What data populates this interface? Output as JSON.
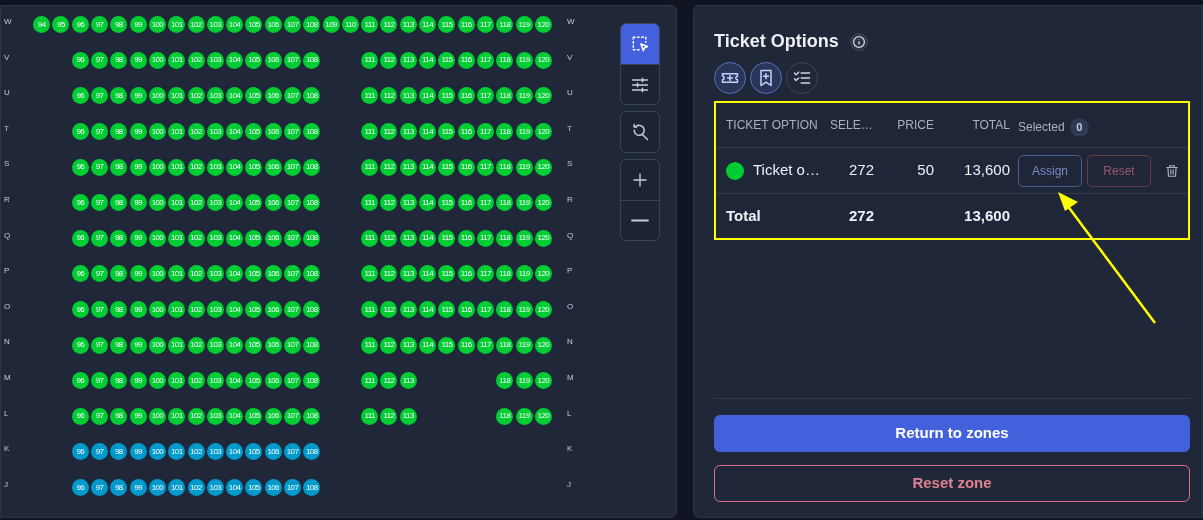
{
  "seat_map": {
    "rows": [
      {
        "label_left": "W",
        "label_right": "W",
        "color": "#00cc33",
        "seats": [
          {
            "kind": "seat",
            "number": "94"
          },
          {
            "kind": "seat",
            "number": "95"
          },
          {
            "kind": "seat",
            "number": "96"
          },
          {
            "kind": "seat",
            "number": "97"
          },
          {
            "kind": "seat",
            "number": "98"
          },
          {
            "kind": "seat",
            "number": "99"
          },
          {
            "kind": "seat",
            "number": "100"
          },
          {
            "kind": "seat",
            "number": "101"
          },
          {
            "kind": "seat",
            "number": "102"
          },
          {
            "kind": "seat",
            "number": "103"
          },
          {
            "kind": "seat",
            "number": "104"
          },
          {
            "kind": "seat",
            "number": "105"
          },
          {
            "kind": "seat",
            "number": "106"
          },
          {
            "kind": "seat",
            "number": "107"
          },
          {
            "kind": "seat",
            "number": "108"
          },
          {
            "kind": "seat",
            "number": "109"
          },
          {
            "kind": "seat",
            "number": "110"
          },
          {
            "kind": "seat",
            "number": "111"
          },
          {
            "kind": "seat",
            "number": "112"
          },
          {
            "kind": "seat",
            "number": "113"
          },
          {
            "kind": "seat",
            "number": "114"
          },
          {
            "kind": "seat",
            "number": "115"
          },
          {
            "kind": "seat",
            "number": "116"
          },
          {
            "kind": "seat",
            "number": "117"
          },
          {
            "kind": "seat",
            "number": "118"
          },
          {
            "kind": "seat",
            "number": "119"
          },
          {
            "kind": "seat",
            "number": "120"
          }
        ]
      },
      {
        "label_left": "V",
        "label_right": "V",
        "color": "#00cc33",
        "seats": [
          {
            "kind": "gap"
          },
          {
            "kind": "gap"
          },
          {
            "kind": "seat",
            "number": "96"
          },
          {
            "kind": "seat",
            "number": "97"
          },
          {
            "kind": "seat",
            "number": "98"
          },
          {
            "kind": "seat",
            "number": "99"
          },
          {
            "kind": "seat",
            "number": "100"
          },
          {
            "kind": "seat",
            "number": "101"
          },
          {
            "kind": "seat",
            "number": "102"
          },
          {
            "kind": "seat",
            "number": "103"
          },
          {
            "kind": "seat",
            "number": "104"
          },
          {
            "kind": "seat",
            "number": "105"
          },
          {
            "kind": "seat",
            "number": "106"
          },
          {
            "kind": "seat",
            "number": "107"
          },
          {
            "kind": "seat",
            "number": "108"
          },
          {
            "kind": "gap"
          },
          {
            "kind": "gap"
          },
          {
            "kind": "seat",
            "number": "111"
          },
          {
            "kind": "seat",
            "number": "112"
          },
          {
            "kind": "seat",
            "number": "113"
          },
          {
            "kind": "seat",
            "number": "114"
          },
          {
            "kind": "seat",
            "number": "115"
          },
          {
            "kind": "seat",
            "number": "116"
          },
          {
            "kind": "seat",
            "number": "117"
          },
          {
            "kind": "seat",
            "number": "118"
          },
          {
            "kind": "seat",
            "number": "119"
          },
          {
            "kind": "seat",
            "number": "120"
          }
        ]
      },
      {
        "label_left": "U",
        "label_right": "U",
        "color": "#00cc33",
        "seats": [
          {
            "kind": "gap"
          },
          {
            "kind": "gap"
          },
          {
            "kind": "seat",
            "number": "96"
          },
          {
            "kind": "seat",
            "number": "97"
          },
          {
            "kind": "seat",
            "number": "98"
          },
          {
            "kind": "seat",
            "number": "99"
          },
          {
            "kind": "seat",
            "number": "100"
          },
          {
            "kind": "seat",
            "number": "101"
          },
          {
            "kind": "seat",
            "number": "102"
          },
          {
            "kind": "seat",
            "number": "103"
          },
          {
            "kind": "seat",
            "number": "104"
          },
          {
            "kind": "seat",
            "number": "105"
          },
          {
            "kind": "seat",
            "number": "106"
          },
          {
            "kind": "seat",
            "number": "107"
          },
          {
            "kind": "seat",
            "number": "108"
          },
          {
            "kind": "gap"
          },
          {
            "kind": "gap"
          },
          {
            "kind": "seat",
            "number": "111"
          },
          {
            "kind": "seat",
            "number": "112"
          },
          {
            "kind": "seat",
            "number": "113"
          },
          {
            "kind": "seat",
            "number": "114"
          },
          {
            "kind": "seat",
            "number": "115"
          },
          {
            "kind": "seat",
            "number": "116"
          },
          {
            "kind": "seat",
            "number": "117"
          },
          {
            "kind": "seat",
            "number": "118"
          },
          {
            "kind": "seat",
            "number": "119"
          },
          {
            "kind": "seat",
            "number": "120"
          }
        ]
      },
      {
        "label_left": "T",
        "label_right": "T",
        "color": "#00cc33",
        "seats": [
          {
            "kind": "gap"
          },
          {
            "kind": "gap"
          },
          {
            "kind": "seat",
            "number": "96"
          },
          {
            "kind": "seat",
            "number": "97"
          },
          {
            "kind": "seat",
            "number": "98"
          },
          {
            "kind": "seat",
            "number": "99"
          },
          {
            "kind": "seat",
            "number": "100"
          },
          {
            "kind": "seat",
            "number": "101"
          },
          {
            "kind": "seat",
            "number": "102"
          },
          {
            "kind": "seat",
            "number": "103"
          },
          {
            "kind": "seat",
            "number": "104"
          },
          {
            "kind": "seat",
            "number": "105"
          },
          {
            "kind": "seat",
            "number": "106"
          },
          {
            "kind": "seat",
            "number": "107"
          },
          {
            "kind": "seat",
            "number": "108"
          },
          {
            "kind": "gap"
          },
          {
            "kind": "gap"
          },
          {
            "kind": "seat",
            "number": "111"
          },
          {
            "kind": "seat",
            "number": "112"
          },
          {
            "kind": "seat",
            "number": "113"
          },
          {
            "kind": "seat",
            "number": "114"
          },
          {
            "kind": "seat",
            "number": "115"
          },
          {
            "kind": "seat",
            "number": "116"
          },
          {
            "kind": "seat",
            "number": "117"
          },
          {
            "kind": "seat",
            "number": "118"
          },
          {
            "kind": "seat",
            "number": "119"
          },
          {
            "kind": "seat",
            "number": "120"
          }
        ]
      },
      {
        "label_left": "S",
        "label_right": "S",
        "color": "#00cc33",
        "seats": [
          {
            "kind": "gap"
          },
          {
            "kind": "gap"
          },
          {
            "kind": "seat",
            "number": "96"
          },
          {
            "kind": "seat",
            "number": "97"
          },
          {
            "kind": "seat",
            "number": "98"
          },
          {
            "kind": "seat",
            "number": "99"
          },
          {
            "kind": "seat",
            "number": "100"
          },
          {
            "kind": "seat",
            "number": "101"
          },
          {
            "kind": "seat",
            "number": "102"
          },
          {
            "kind": "seat",
            "number": "103"
          },
          {
            "kind": "seat",
            "number": "104"
          },
          {
            "kind": "seat",
            "number": "105"
          },
          {
            "kind": "seat",
            "number": "106"
          },
          {
            "kind": "seat",
            "number": "107"
          },
          {
            "kind": "seat",
            "number": "108"
          },
          {
            "kind": "gap"
          },
          {
            "kind": "gap"
          },
          {
            "kind": "seat",
            "number": "111"
          },
          {
            "kind": "seat",
            "number": "112"
          },
          {
            "kind": "seat",
            "number": "113"
          },
          {
            "kind": "seat",
            "number": "114"
          },
          {
            "kind": "seat",
            "number": "115"
          },
          {
            "kind": "seat",
            "number": "116"
          },
          {
            "kind": "seat",
            "number": "117"
          },
          {
            "kind": "seat",
            "number": "118"
          },
          {
            "kind": "seat",
            "number": "119"
          },
          {
            "kind": "seat",
            "number": "120"
          }
        ]
      },
      {
        "label_left": "R",
        "label_right": "R",
        "color": "#00cc33",
        "seats": [
          {
            "kind": "gap"
          },
          {
            "kind": "gap"
          },
          {
            "kind": "seat",
            "number": "96"
          },
          {
            "kind": "seat",
            "number": "97"
          },
          {
            "kind": "seat",
            "number": "98"
          },
          {
            "kind": "seat",
            "number": "99"
          },
          {
            "kind": "seat",
            "number": "100"
          },
          {
            "kind": "seat",
            "number": "101"
          },
          {
            "kind": "seat",
            "number": "102"
          },
          {
            "kind": "seat",
            "number": "103"
          },
          {
            "kind": "seat",
            "number": "104"
          },
          {
            "kind": "seat",
            "number": "105"
          },
          {
            "kind": "seat",
            "number": "106"
          },
          {
            "kind": "seat",
            "number": "107"
          },
          {
            "kind": "seat",
            "number": "108"
          },
          {
            "kind": "gap"
          },
          {
            "kind": "gap"
          },
          {
            "kind": "seat",
            "number": "111"
          },
          {
            "kind": "seat",
            "number": "112"
          },
          {
            "kind": "seat",
            "number": "113"
          },
          {
            "kind": "seat",
            "number": "114"
          },
          {
            "kind": "seat",
            "number": "115"
          },
          {
            "kind": "seat",
            "number": "116"
          },
          {
            "kind": "seat",
            "number": "117"
          },
          {
            "kind": "seat",
            "number": "118"
          },
          {
            "kind": "seat",
            "number": "119"
          },
          {
            "kind": "seat",
            "number": "120"
          }
        ]
      },
      {
        "label_left": "Q",
        "label_right": "Q",
        "color": "#00cc33",
        "seats": [
          {
            "kind": "gap"
          },
          {
            "kind": "gap"
          },
          {
            "kind": "seat",
            "number": "96"
          },
          {
            "kind": "seat",
            "number": "97"
          },
          {
            "kind": "seat",
            "number": "98"
          },
          {
            "kind": "seat",
            "number": "99"
          },
          {
            "kind": "seat",
            "number": "100"
          },
          {
            "kind": "seat",
            "number": "101"
          },
          {
            "kind": "seat",
            "number": "102"
          },
          {
            "kind": "seat",
            "number": "103"
          },
          {
            "kind": "seat",
            "number": "104"
          },
          {
            "kind": "seat",
            "number": "105"
          },
          {
            "kind": "seat",
            "number": "106"
          },
          {
            "kind": "seat",
            "number": "107"
          },
          {
            "kind": "seat",
            "number": "108"
          },
          {
            "kind": "gap"
          },
          {
            "kind": "gap"
          },
          {
            "kind": "seat",
            "number": "111"
          },
          {
            "kind": "seat",
            "number": "112"
          },
          {
            "kind": "seat",
            "number": "113"
          },
          {
            "kind": "seat",
            "number": "114"
          },
          {
            "kind": "seat",
            "number": "115"
          },
          {
            "kind": "seat",
            "number": "116"
          },
          {
            "kind": "seat",
            "number": "117"
          },
          {
            "kind": "seat",
            "number": "118"
          },
          {
            "kind": "seat",
            "number": "119"
          },
          {
            "kind": "seat",
            "number": "120"
          }
        ]
      },
      {
        "label_left": "P",
        "label_right": "P",
        "color": "#00cc33",
        "seats": [
          {
            "kind": "gap"
          },
          {
            "kind": "gap"
          },
          {
            "kind": "seat",
            "number": "96"
          },
          {
            "kind": "seat",
            "number": "97"
          },
          {
            "kind": "seat",
            "number": "98"
          },
          {
            "kind": "seat",
            "number": "99"
          },
          {
            "kind": "seat",
            "number": "100"
          },
          {
            "kind": "seat",
            "number": "101"
          },
          {
            "kind": "seat",
            "number": "102"
          },
          {
            "kind": "seat",
            "number": "103"
          },
          {
            "kind": "seat",
            "number": "104"
          },
          {
            "kind": "seat",
            "number": "105"
          },
          {
            "kind": "seat",
            "number": "106"
          },
          {
            "kind": "seat",
            "number": "107"
          },
          {
            "kind": "seat",
            "number": "108"
          },
          {
            "kind": "gap"
          },
          {
            "kind": "gap"
          },
          {
            "kind": "seat",
            "number": "111"
          },
          {
            "kind": "seat",
            "number": "112"
          },
          {
            "kind": "seat",
            "number": "113"
          },
          {
            "kind": "seat",
            "number": "114"
          },
          {
            "kind": "seat",
            "number": "115"
          },
          {
            "kind": "seat",
            "number": "116"
          },
          {
            "kind": "seat",
            "number": "117"
          },
          {
            "kind": "seat",
            "number": "118"
          },
          {
            "kind": "seat",
            "number": "119"
          },
          {
            "kind": "seat",
            "number": "120"
          }
        ]
      },
      {
        "label_left": "O",
        "label_right": "O",
        "color": "#00cc33",
        "seats": [
          {
            "kind": "gap"
          },
          {
            "kind": "gap"
          },
          {
            "kind": "seat",
            "number": "96"
          },
          {
            "kind": "seat",
            "number": "97"
          },
          {
            "kind": "seat",
            "number": "98"
          },
          {
            "kind": "seat",
            "number": "99"
          },
          {
            "kind": "seat",
            "number": "100"
          },
          {
            "kind": "seat",
            "number": "101"
          },
          {
            "kind": "seat",
            "number": "102"
          },
          {
            "kind": "seat",
            "number": "103"
          },
          {
            "kind": "seat",
            "number": "104"
          },
          {
            "kind": "seat",
            "number": "105"
          },
          {
            "kind": "seat",
            "number": "106"
          },
          {
            "kind": "seat",
            "number": "107"
          },
          {
            "kind": "seat",
            "number": "108"
          },
          {
            "kind": "gap"
          },
          {
            "kind": "gap"
          },
          {
            "kind": "seat",
            "number": "111"
          },
          {
            "kind": "seat",
            "number": "112"
          },
          {
            "kind": "seat",
            "number": "113"
          },
          {
            "kind": "seat",
            "number": "114"
          },
          {
            "kind": "seat",
            "number": "115"
          },
          {
            "kind": "seat",
            "number": "116"
          },
          {
            "kind": "seat",
            "number": "117"
          },
          {
            "kind": "seat",
            "number": "118"
          },
          {
            "kind": "seat",
            "number": "119"
          },
          {
            "kind": "seat",
            "number": "120"
          }
        ]
      },
      {
        "label_left": "N",
        "label_right": "N",
        "color": "#00cc33",
        "seats": [
          {
            "kind": "gap"
          },
          {
            "kind": "gap"
          },
          {
            "kind": "seat",
            "number": "96"
          },
          {
            "kind": "seat",
            "number": "97"
          },
          {
            "kind": "seat",
            "number": "98"
          },
          {
            "kind": "seat",
            "number": "99"
          },
          {
            "kind": "seat",
            "number": "100"
          },
          {
            "kind": "seat",
            "number": "101"
          },
          {
            "kind": "seat",
            "number": "102"
          },
          {
            "kind": "seat",
            "number": "103"
          },
          {
            "kind": "seat",
            "number": "104"
          },
          {
            "kind": "seat",
            "number": "105"
          },
          {
            "kind": "seat",
            "number": "106"
          },
          {
            "kind": "seat",
            "number": "107"
          },
          {
            "kind": "seat",
            "number": "108"
          },
          {
            "kind": "gap"
          },
          {
            "kind": "gap"
          },
          {
            "kind": "seat",
            "number": "111"
          },
          {
            "kind": "seat",
            "number": "112"
          },
          {
            "kind": "seat",
            "number": "113"
          },
          {
            "kind": "seat",
            "number": "114"
          },
          {
            "kind": "seat",
            "number": "115"
          },
          {
            "kind": "seat",
            "number": "116"
          },
          {
            "kind": "seat",
            "number": "117"
          },
          {
            "kind": "seat",
            "number": "118"
          },
          {
            "kind": "seat",
            "number": "119"
          },
          {
            "kind": "seat",
            "number": "120"
          }
        ]
      },
      {
        "label_left": "M",
        "label_right": "M",
        "color": "#00cc33",
        "seats": [
          {
            "kind": "gap"
          },
          {
            "kind": "gap"
          },
          {
            "kind": "seat",
            "number": "96"
          },
          {
            "kind": "seat",
            "number": "97"
          },
          {
            "kind": "seat",
            "number": "98"
          },
          {
            "kind": "seat",
            "number": "99"
          },
          {
            "kind": "seat",
            "number": "100"
          },
          {
            "kind": "seat",
            "number": "101"
          },
          {
            "kind": "seat",
            "number": "102"
          },
          {
            "kind": "seat",
            "number": "103"
          },
          {
            "kind": "seat",
            "number": "104"
          },
          {
            "kind": "seat",
            "number": "105"
          },
          {
            "kind": "seat",
            "number": "106"
          },
          {
            "kind": "seat",
            "number": "107"
          },
          {
            "kind": "seat",
            "number": "108"
          },
          {
            "kind": "gap"
          },
          {
            "kind": "gap"
          },
          {
            "kind": "seat",
            "number": "111"
          },
          {
            "kind": "seat",
            "number": "112"
          },
          {
            "kind": "seat",
            "number": "113"
          },
          {
            "kind": "gap"
          },
          {
            "kind": "gap"
          },
          {
            "kind": "gap"
          },
          {
            "kind": "gap"
          },
          {
            "kind": "seat",
            "number": "118"
          },
          {
            "kind": "seat",
            "number": "119"
          },
          {
            "kind": "seat",
            "number": "120"
          }
        ]
      },
      {
        "label_left": "L",
        "label_right": "L",
        "color": "#00cc33",
        "seats": [
          {
            "kind": "gap"
          },
          {
            "kind": "gap"
          },
          {
            "kind": "seat",
            "number": "96"
          },
          {
            "kind": "seat",
            "number": "97"
          },
          {
            "kind": "seat",
            "number": "98"
          },
          {
            "kind": "seat",
            "number": "99"
          },
          {
            "kind": "seat",
            "number": "100"
          },
          {
            "kind": "seat",
            "number": "101"
          },
          {
            "kind": "seat",
            "number": "102"
          },
          {
            "kind": "seat",
            "number": "103"
          },
          {
            "kind": "seat",
            "number": "104"
          },
          {
            "kind": "seat",
            "number": "105"
          },
          {
            "kind": "seat",
            "number": "106"
          },
          {
            "kind": "seat",
            "number": "107"
          },
          {
            "kind": "seat",
            "number": "108"
          },
          {
            "kind": "gap"
          },
          {
            "kind": "gap"
          },
          {
            "kind": "seat",
            "number": "111"
          },
          {
            "kind": "seat",
            "number": "112"
          },
          {
            "kind": "seat",
            "number": "113"
          },
          {
            "kind": "gap"
          },
          {
            "kind": "gap"
          },
          {
            "kind": "gap"
          },
          {
            "kind": "gap"
          },
          {
            "kind": "seat",
            "number": "118"
          },
          {
            "kind": "seat",
            "number": "119"
          },
          {
            "kind": "seat",
            "number": "120"
          }
        ]
      },
      {
        "label_left": "K",
        "label_right": "K",
        "color": "#0099cc",
        "seats": [
          {
            "kind": "gap"
          },
          {
            "kind": "gap"
          },
          {
            "kind": "seat",
            "number": "96"
          },
          {
            "kind": "seat",
            "number": "97"
          },
          {
            "kind": "seat",
            "number": "98"
          },
          {
            "kind": "seat",
            "number": "99"
          },
          {
            "kind": "seat",
            "number": "100"
          },
          {
            "kind": "seat",
            "number": "101"
          },
          {
            "kind": "seat",
            "number": "102"
          },
          {
            "kind": "seat",
            "number": "103"
          },
          {
            "kind": "seat",
            "number": "104"
          },
          {
            "kind": "seat",
            "number": "105"
          },
          {
            "kind": "seat",
            "number": "106"
          },
          {
            "kind": "seat",
            "number": "107"
          },
          {
            "kind": "seat",
            "number": "108"
          }
        ]
      },
      {
        "label_left": "J",
        "label_right": "J",
        "color": "#0099cc",
        "seats": [
          {
            "kind": "gap"
          },
          {
            "kind": "gap"
          },
          {
            "kind": "seat",
            "number": "96"
          },
          {
            "kind": "seat",
            "number": "97"
          },
          {
            "kind": "seat",
            "number": "98"
          },
          {
            "kind": "seat",
            "number": "99"
          },
          {
            "kind": "seat",
            "number": "100"
          },
          {
            "kind": "seat",
            "number": "101"
          },
          {
            "kind": "seat",
            "number": "102"
          },
          {
            "kind": "seat",
            "number": "103"
          },
          {
            "kind": "seat",
            "number": "104"
          },
          {
            "kind": "seat",
            "number": "105"
          },
          {
            "kind": "seat",
            "number": "106"
          },
          {
            "kind": "seat",
            "number": "107"
          },
          {
            "kind": "seat",
            "number": "108"
          }
        ]
      }
    ],
    "tool_groups": [
      [
        {
          "kind": "select",
          "selected": true
        },
        {
          "kind": "adjust",
          "selected": false
        }
      ],
      [
        {
          "kind": "reset_zoom",
          "selected": false
        }
      ],
      [
        {
          "kind": "zoom_in",
          "selected": false
        },
        {
          "kind": "zoom_out",
          "selected": false
        }
      ]
    ]
  },
  "panel": {
    "title": "Ticket Options",
    "view_buttons": [
      {
        "kind": "ticket",
        "selected": true
      },
      {
        "kind": "bookmark",
        "selected": true
      },
      {
        "kind": "checklist",
        "selected": false
      }
    ],
    "table": {
      "columns": [
        "TICKET OPTION",
        "SELE…",
        "PRICE",
        "TOTAL"
      ],
      "selected_label": "Selected",
      "selected_count": "0",
      "rows": [
        {
          "color": "#00cc33",
          "name": "Ticket o…",
          "selected": "272",
          "price": "50",
          "total": "13,600",
          "assign": "Assign",
          "reset": "Reset"
        }
      ],
      "total": {
        "label": "Total",
        "selected": "272",
        "total": "13,600"
      }
    },
    "buttons": {
      "primary": "Return to zones",
      "secondary": "Reset zone"
    }
  }
}
